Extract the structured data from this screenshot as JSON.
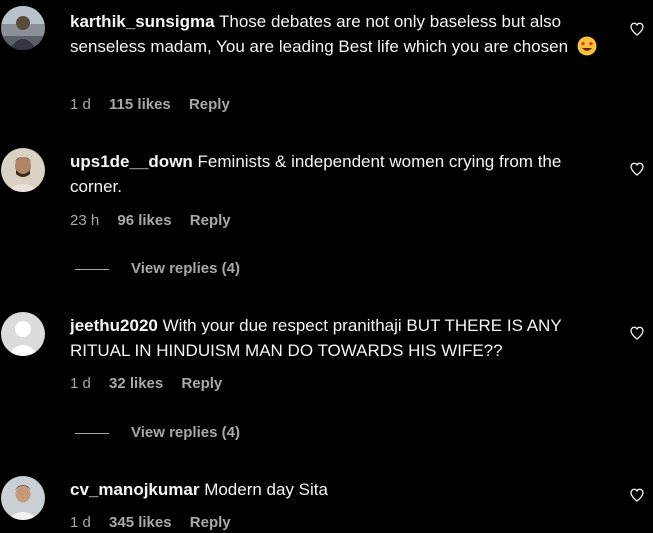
{
  "colors": {
    "background": "#000000",
    "text": "#f5f5f5",
    "secondary": "#a8a8a8"
  },
  "comments": [
    {
      "username": "karthik_sunsigma",
      "text": "Those debates are not only baseless but also senseless madam, You are leading Best life which you are chosen",
      "emoji_icon": "star-struck-emoji",
      "time": "1 d",
      "likes": "115 likes",
      "reply": "Reply"
    },
    {
      "username": "ups1de__down",
      "text": "Feminists & independent women crying from the corner.",
      "time": "23 h",
      "likes": "96 likes",
      "reply": "Reply",
      "view_replies": "View replies (4)"
    },
    {
      "username": "jeethu2020",
      "text": "With your due respect pranithaji BUT THERE IS ANY RITUAL IN HINDUISM MAN DO TOWARDS HIS WIFE??",
      "time": "1 d",
      "likes": "32 likes",
      "reply": "Reply",
      "view_replies": "View replies (4)"
    },
    {
      "username": "cv_manojkumar",
      "text": "Modern day Sita",
      "time": "1 d",
      "likes": "345 likes",
      "reply": "Reply"
    }
  ]
}
